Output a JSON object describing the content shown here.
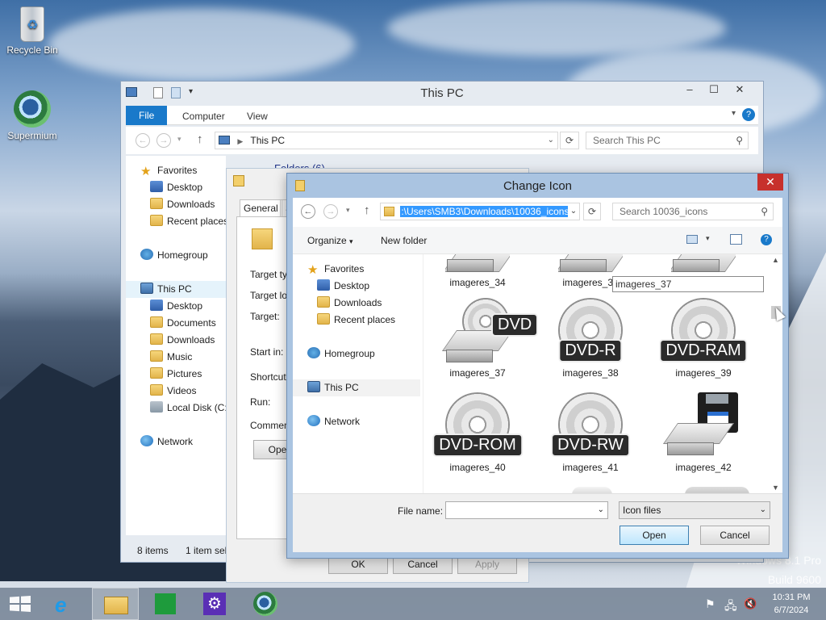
{
  "desktop": {
    "icons": [
      {
        "label": "Recycle Bin"
      },
      {
        "label": "Supermium"
      }
    ],
    "watermark": {
      "edition": "Windows 8.1 Pro",
      "build": "Build 9600"
    }
  },
  "explorer": {
    "title": "This PC",
    "tabs": {
      "file": "File",
      "computer": "Computer",
      "view": "View"
    },
    "address": "This PC",
    "search_placeholder": "Search This PC",
    "content_header": "Folders (6)",
    "nav": {
      "favorites": "Favorites",
      "desktop": "Desktop",
      "downloads": "Downloads",
      "recent": "Recent places",
      "homegroup": "Homegroup",
      "this_pc": "This PC",
      "pc_desktop": "Desktop",
      "documents": "Documents",
      "pc_downloads": "Downloads",
      "music": "Music",
      "pictures": "Pictures",
      "videos": "Videos",
      "local_disk": "Local Disk (C:",
      "network": "Network"
    },
    "status": {
      "items": "8 items",
      "selected": "1 item sel"
    }
  },
  "properties": {
    "tabs": {
      "general": "General",
      "shortcut": "S"
    },
    "labels": {
      "target_type": "Target ty",
      "target_location": "Target lo",
      "target": "Target:",
      "start_in": "Start in:",
      "shortcut_key": "Shortcut",
      "run": "Run:",
      "comment": "Commen"
    },
    "open_button": "Ope",
    "ok": "OK",
    "cancel": "Cancel",
    "apply": "Apply"
  },
  "change_icon": {
    "title": "Change Icon",
    "close": "✕",
    "path": ":\\Users\\SMB3\\Downloads\\10036_icons",
    "search_placeholder": "Search 10036_icons",
    "organize": "Organize",
    "new_folder": "New folder",
    "nav": {
      "favorites": "Favorites",
      "desktop": "Desktop",
      "downloads": "Downloads",
      "recent": "Recent places",
      "homegroup": "Homegroup",
      "this_pc": "This PC",
      "network": "Network"
    },
    "rename_value": "imageres_37",
    "icons": [
      {
        "name": "imageres_34",
        "kind": "drive",
        "badge": ""
      },
      {
        "name": "imageres_35",
        "kind": "drive",
        "badge": ""
      },
      {
        "name": "imageres_37",
        "kind": "dvd-drive",
        "badge": "DVD"
      },
      {
        "name": "imageres_38",
        "kind": "disc",
        "badge": "DVD-R"
      },
      {
        "name": "imageres_39",
        "kind": "disc",
        "badge": "DVD-RAM"
      },
      {
        "name": "imageres_40",
        "kind": "disc",
        "badge": "DVD-ROM"
      },
      {
        "name": "imageres_41",
        "kind": "disc",
        "badge": "DVD-RW"
      },
      {
        "name": "imageres_42",
        "kind": "floppy-drive",
        "badge": ""
      }
    ],
    "file_name_label": "File name:",
    "file_name_value": "",
    "file_type": "Icon files",
    "open": "Open",
    "cancel": "Cancel"
  },
  "taskbar": {
    "time": "10:31 PM",
    "date": "6/7/2024"
  },
  "colors": {
    "accent": "#1979ca",
    "close_red": "#c7302c",
    "selection": "#e5f3fb"
  }
}
